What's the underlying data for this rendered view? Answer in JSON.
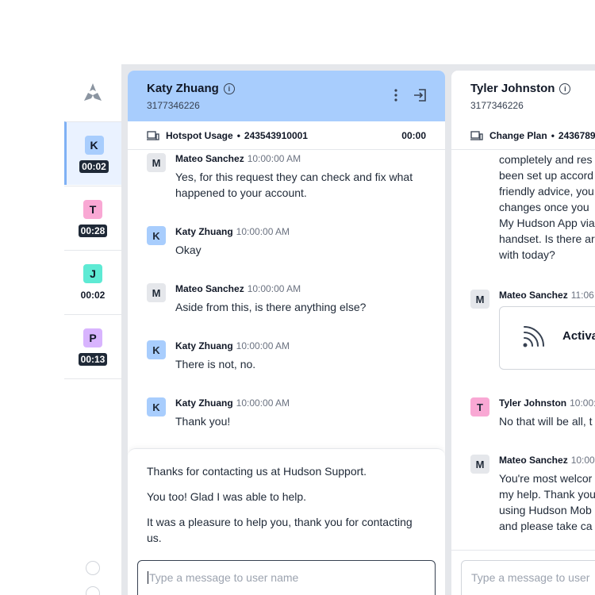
{
  "rail": {
    "items": [
      {
        "initial": "K",
        "timer": "00:02",
        "color": "#a8cdfd",
        "active": true,
        "dark": true
      },
      {
        "initial": "T",
        "timer": "00:28",
        "color": "#f9a8d4",
        "active": false,
        "dark": true
      },
      {
        "initial": "J",
        "timer": "00:02",
        "color": "#5eead4",
        "active": false,
        "dark": false
      },
      {
        "initial": "P",
        "timer": "00:13",
        "color": "#d8b4fe",
        "active": false,
        "dark": true
      }
    ]
  },
  "panel1": {
    "name": "Katy Zhuang",
    "info_icon": "i",
    "phone": "3177346226",
    "bar": {
      "topic": "Hotspot Usage",
      "sep": "•",
      "account": "243543910001",
      "time": "00:00"
    },
    "messages": [
      {
        "initial": "M",
        "author": "Mateo Sanchez",
        "time": "10:00:00 AM",
        "lines": [
          "Yes, for this request they can check and fix what",
          "happened to your account."
        ],
        "color": "#e5e7eb"
      },
      {
        "initial": "K",
        "author": "Katy Zhuang",
        "time": "10:00:00 AM",
        "lines": [
          "Okay"
        ],
        "color": "#a8cdfd"
      },
      {
        "initial": "M",
        "author": "Mateo Sanchez",
        "time": "10:00:00 AM",
        "lines": [
          "Aside from this, is there anything else?"
        ],
        "color": "#e5e7eb"
      },
      {
        "initial": "K",
        "author": "Katy Zhuang",
        "time": "10:00:00 AM",
        "lines": [
          "There is not, no."
        ],
        "color": "#a8cdfd"
      },
      {
        "initial": "K",
        "author": "Katy Zhuang",
        "time": "10:00:00 AM",
        "lines": [
          "Thank you!"
        ],
        "color": "#a8cdfd"
      }
    ],
    "quick_replies": [
      "Thanks for contacting us at Hudson Support.",
      "You too! Glad I was able to help.",
      "It was a pleasure to help you, thank you for contacting us."
    ],
    "input_placeholder": "Type a message to user name"
  },
  "panel2": {
    "name": "Tyler Johnston",
    "info_icon": "i",
    "phone": "3177346226",
    "bar": {
      "topic": "Change Plan",
      "sep": "•",
      "account": "2436789"
    },
    "prev_lines": [
      "completely and res",
      "been set up accord",
      "friendly advice, you",
      "changes once you",
      "My Hudson App via",
      "handset. Is there ar",
      "with today?"
    ],
    "messages": [
      {
        "initial": "M",
        "author": "Mateo Sanchez",
        "time": "11:06",
        "color": "#e5e7eb",
        "lines": []
      },
      {
        "initial": "T",
        "author": "Tyler Johnston",
        "time": "10:00:",
        "color": "#f9a8d4",
        "lines": [
          "No that will be all, t"
        ]
      },
      {
        "initial": "M",
        "author": "Mateo Sanchez",
        "time": "10:00",
        "color": "#e5e7eb",
        "lines": [
          "You're most welcor",
          "my help. Thank you",
          "using Hudson Mob",
          "and please take ca"
        ]
      }
    ],
    "card_text": "Activa",
    "input_placeholder": "Type a message to user"
  }
}
